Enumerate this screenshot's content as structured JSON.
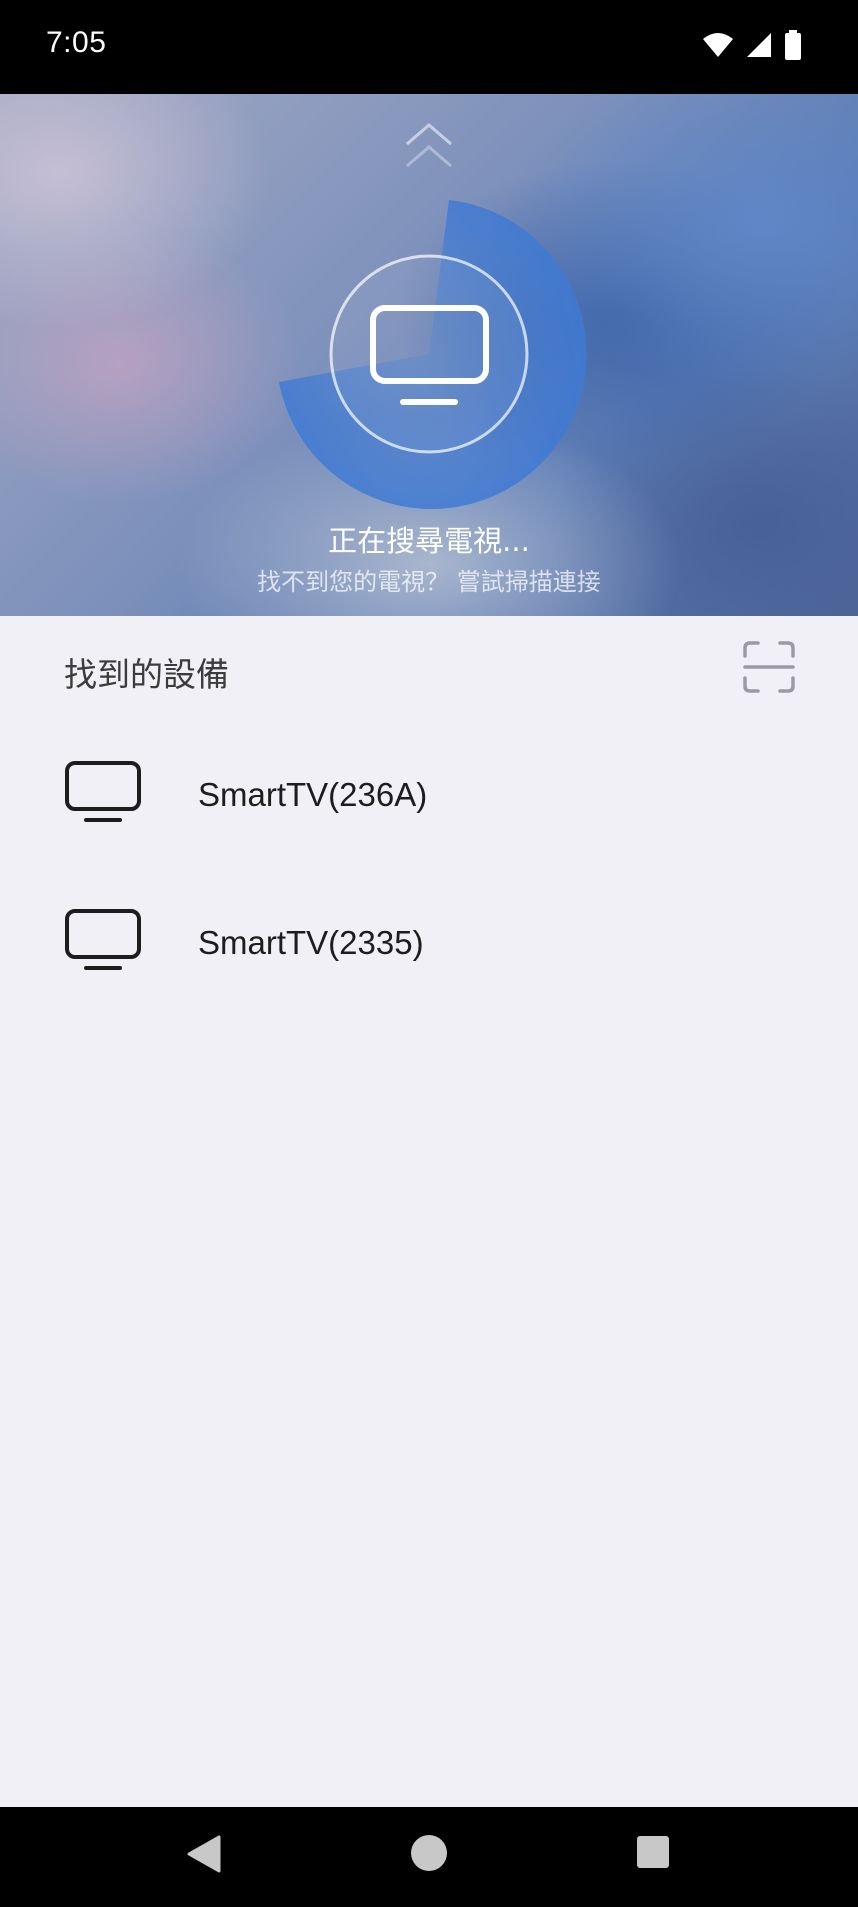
{
  "status_bar": {
    "time": "7:05",
    "icons": [
      "wifi-icon",
      "signal-icon",
      "battery-icon"
    ]
  },
  "hero": {
    "collapse_icon": "chevron-up-icon",
    "center_icon": "tv-icon",
    "title": "正在搜尋電視...",
    "subtitle": "找不到您的電視？ 嘗試掃描連接"
  },
  "devices_section": {
    "title": "找到的設備",
    "scan_icon": "scan-icon",
    "devices": [
      {
        "name": "SmartTV(236A)",
        "icon": "tv-icon"
      },
      {
        "name": "SmartTV(2335)",
        "icon": "tv-icon"
      }
    ]
  },
  "nav_bar": {
    "buttons": [
      "back-icon",
      "home-icon",
      "recents-icon"
    ]
  },
  "colors": {
    "status_bar_bg": "#000000",
    "page_bg": "#f0f0f6",
    "text_primary": "#1d1d1d",
    "hero_title": "#ffffff"
  }
}
